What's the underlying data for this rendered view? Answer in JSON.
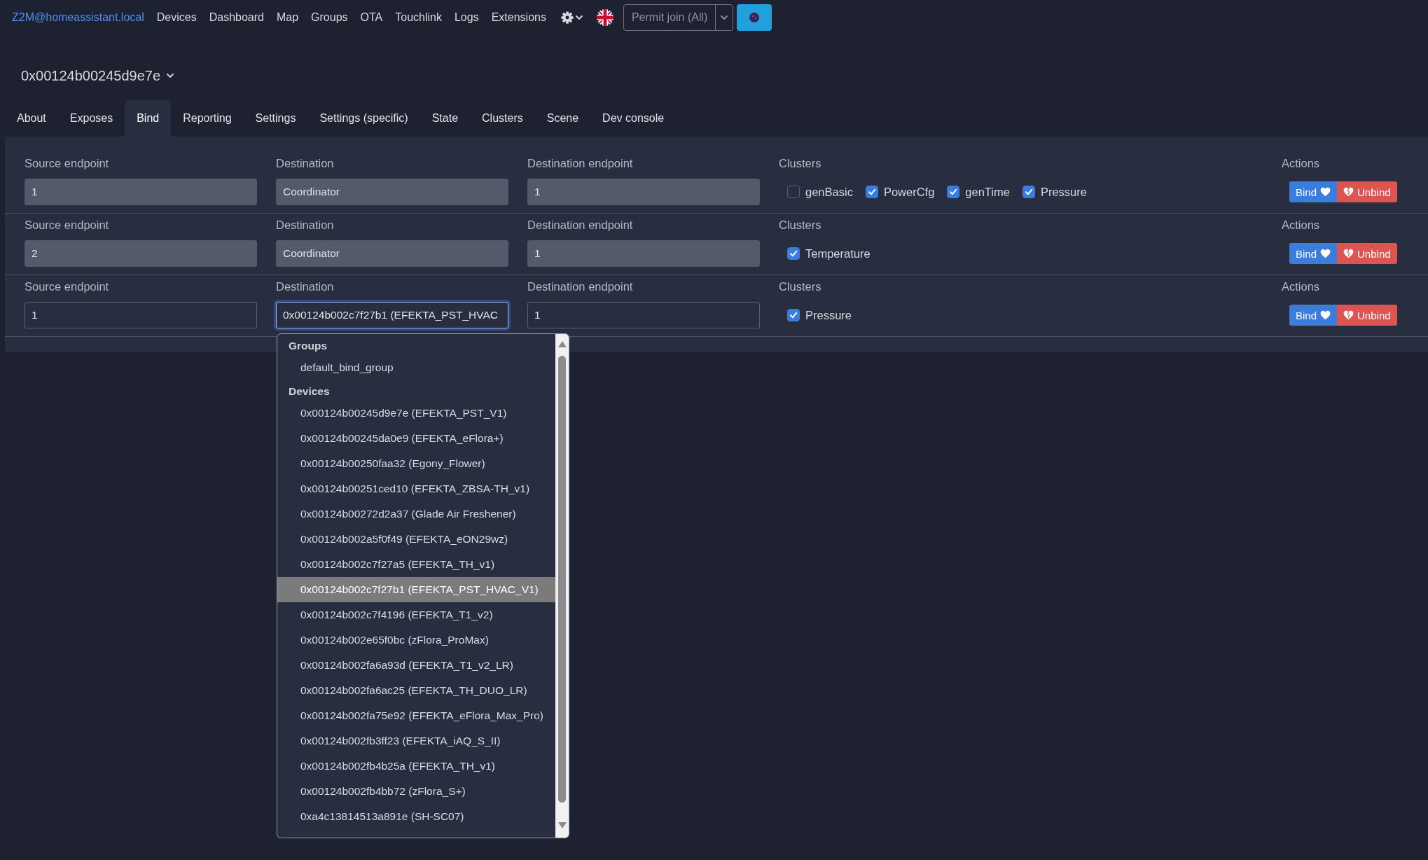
{
  "nav": {
    "brand": "Z2M@homeassistant.local",
    "links": [
      "Devices",
      "Dashboard",
      "Map",
      "Groups",
      "OTA",
      "Touchlink",
      "Logs",
      "Extensions"
    ],
    "permit_join": {
      "label": "Permit join (All)"
    }
  },
  "device": {
    "title": "0x00124b00245d9e7e"
  },
  "tabs": [
    {
      "label": "About",
      "selected": false
    },
    {
      "label": "Exposes",
      "selected": false
    },
    {
      "label": "Bind",
      "selected": true
    },
    {
      "label": "Reporting",
      "selected": false
    },
    {
      "label": "Settings",
      "selected": false
    },
    {
      "label": "Settings (specific)",
      "selected": false
    },
    {
      "label": "State",
      "selected": false
    },
    {
      "label": "Clusters",
      "selected": false
    },
    {
      "label": "Scene",
      "selected": false
    },
    {
      "label": "Dev console",
      "selected": false
    }
  ],
  "bind_rows": [
    {
      "fields": [
        {
          "label": "Source endpoint",
          "value": "1",
          "disabled": true,
          "focused": false
        },
        {
          "label": "Destination",
          "value": "Coordinator",
          "disabled": true,
          "focused": false
        },
        {
          "label": "Destination endpoint",
          "value": "1",
          "disabled": true,
          "focused": false
        }
      ],
      "clusters": {
        "label": "Clusters",
        "items": [
          {
            "label": "genBasic",
            "checked": false
          },
          {
            "label": "PowerCfg",
            "checked": true
          },
          {
            "label": "genTime",
            "checked": true
          },
          {
            "label": "Pressure",
            "checked": true
          }
        ]
      },
      "actions": {
        "label": "Actions",
        "buttons": [
          {
            "label": "Bind",
            "kind": "bind"
          },
          {
            "label": "Unbind",
            "kind": "unbind"
          }
        ]
      }
    },
    {
      "fields": [
        {
          "label": "Source endpoint",
          "value": "2",
          "disabled": true,
          "focused": false
        },
        {
          "label": "Destination",
          "value": "Coordinator",
          "disabled": true,
          "focused": false
        },
        {
          "label": "Destination endpoint",
          "value": "1",
          "disabled": true,
          "focused": false
        }
      ],
      "clusters": {
        "label": "Clusters",
        "items": [
          {
            "label": "Temperature",
            "checked": true
          }
        ]
      },
      "actions": {
        "label": "Actions",
        "buttons": [
          {
            "label": "Bind",
            "kind": "bind"
          },
          {
            "label": "Unbind",
            "kind": "unbind"
          }
        ]
      }
    },
    {
      "fields": [
        {
          "label": "Source endpoint",
          "value": "1",
          "disabled": false,
          "focused": false
        },
        {
          "label": "Destination",
          "value": "0x00124b002c7f27b1 (EFEKTA_PST_HVAC",
          "disabled": false,
          "focused": true
        },
        {
          "label": "Destination endpoint",
          "value": "1",
          "disabled": false,
          "focused": false
        }
      ],
      "clusters": {
        "label": "Clusters",
        "items": [
          {
            "label": "Pressure",
            "checked": true
          }
        ]
      },
      "actions": {
        "label": "Actions",
        "buttons": [
          {
            "label": "Bind",
            "kind": "bind"
          },
          {
            "label": "Unbind",
            "kind": "unbind"
          }
        ]
      }
    }
  ],
  "destination_list": {
    "sections": [
      {
        "heading": "Groups",
        "options": [
          {
            "label": "default_bind_group",
            "selected": false
          }
        ]
      },
      {
        "heading": "Devices",
        "options": [
          {
            "label": "0x00124b00245d9e7e (EFEKTA_PST_V1)",
            "selected": false
          },
          {
            "label": "0x00124b00245da0e9 (EFEKTA_eFlora+)",
            "selected": false
          },
          {
            "label": "0x00124b00250faa32 (Egony_Flower)",
            "selected": false
          },
          {
            "label": "0x00124b00251ced10 (EFEKTA_ZBSA-TH_v1)",
            "selected": false
          },
          {
            "label": "0x00124b00272d2a37 (Glade Air Freshener)",
            "selected": false
          },
          {
            "label": "0x00124b002a5f0f49 (EFEKTA_eON29wz)",
            "selected": false
          },
          {
            "label": "0x00124b002c7f27a5 (EFEKTA_TH_v1)",
            "selected": false
          },
          {
            "label": "0x00124b002c7f27b1 (EFEKTA_PST_HVAC_V1)",
            "selected": true
          },
          {
            "label": "0x00124b002c7f4196 (EFEKTA_T1_v2)",
            "selected": false
          },
          {
            "label": "0x00124b002e65f0bc (zFlora_ProMax)",
            "selected": false
          },
          {
            "label": "0x00124b002fa6a93d (EFEKTA_T1_v2_LR)",
            "selected": false
          },
          {
            "label": "0x00124b002fa6ac25 (EFEKTA_TH_DUO_LR)",
            "selected": false
          },
          {
            "label": "0x00124b002fa75e92 (EFEKTA_eFlora_Max_Pro)",
            "selected": false
          },
          {
            "label": "0x00124b002fb3ff23 (EFEKTA_iAQ_S_II)",
            "selected": false
          },
          {
            "label": "0x00124b002fb4b25a (EFEKTA_TH_v1)",
            "selected": false
          },
          {
            "label": "0x00124b002fb4bb72 (zFlora_S+)",
            "selected": false
          },
          {
            "label": "0xa4c13814513a891e (SH-SC07)",
            "selected": false
          }
        ]
      }
    ]
  }
}
